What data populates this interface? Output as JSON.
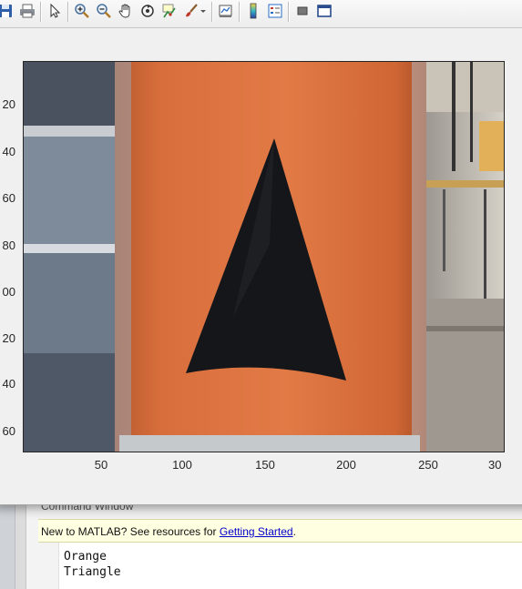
{
  "command_window": {
    "title": "Command Window",
    "notice_text": "New to MATLAB? See resources for ",
    "notice_link": "Getting Started",
    "notice_tail": ".",
    "output_lines": [
      "Orange",
      "Triangle"
    ]
  },
  "figure": {
    "toolbar_icons": [
      "save-icon",
      "print-icon",
      "pointer-icon",
      "zoom-in-icon",
      "zoom-out-icon",
      "pan-icon",
      "rotate-icon",
      "data-cursor-icon",
      "brush-icon",
      "brush-dropdown-icon",
      "link-plot-icon",
      "colorbar-icon",
      "legend-icon",
      "hide-plot-tools-icon",
      "show-plot-tools-icon"
    ],
    "axes": {
      "y_tick_labels": [
        "20",
        "40",
        "60",
        "80",
        "00",
        "20",
        "40",
        "60"
      ],
      "x_tick_labels": [
        "50",
        "100",
        "150",
        "200",
        "250",
        "30"
      ]
    },
    "colors": {
      "cylinder": "#d6703f",
      "triangle": "#14161a",
      "background_wall": "#5d6a7a"
    }
  }
}
